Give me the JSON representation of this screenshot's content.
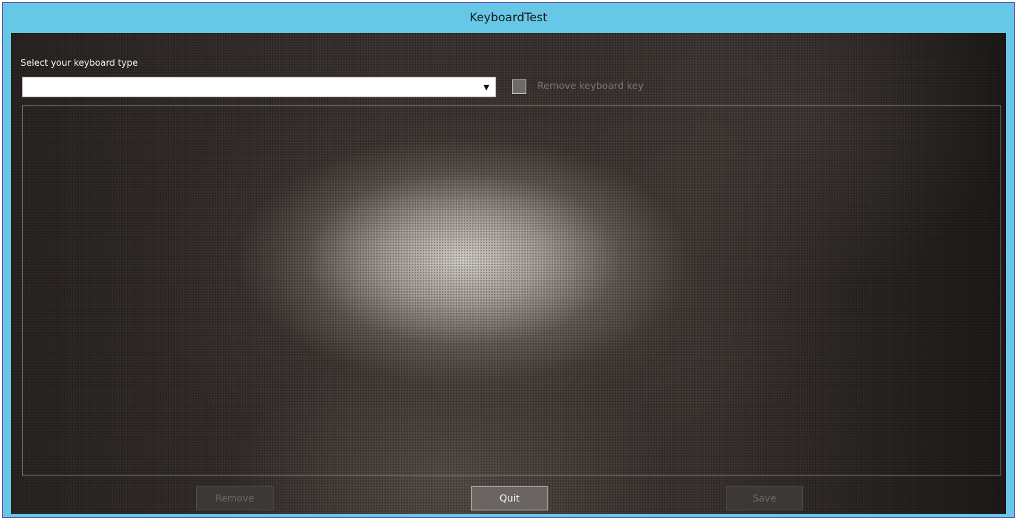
{
  "window": {
    "title": "KeyboardTest"
  },
  "keyboard_select": {
    "label": "Select your keyboard type",
    "value": "",
    "arrow": "▼"
  },
  "remove_key_checkbox": {
    "label": "Remove keyboard key",
    "checked": false,
    "enabled": false
  },
  "buttons": {
    "remove": {
      "label": "Remove",
      "enabled": false
    },
    "quit": {
      "label": "Quit",
      "enabled": true
    },
    "save": {
      "label": "Save",
      "enabled": false
    }
  },
  "colors": {
    "titlebar": "#66c8e6",
    "frame_outline": "#6b4aa8"
  },
  "icons": {
    "dropdown": "chevron-down-icon",
    "checkbox": "checkbox-icon"
  }
}
